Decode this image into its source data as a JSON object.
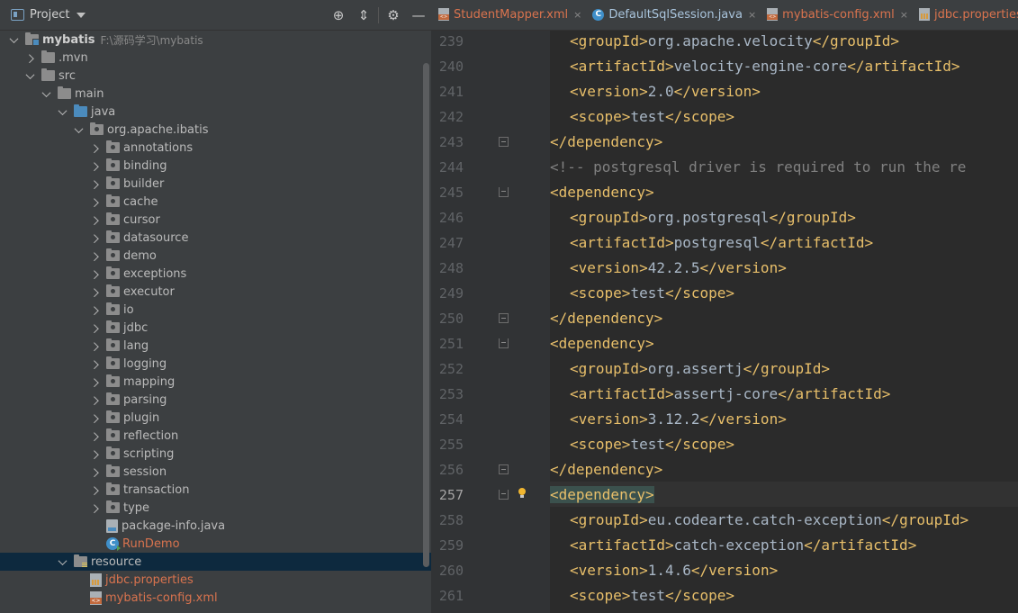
{
  "project_panel": {
    "title": "Project",
    "tools": [
      {
        "name": "locate-icon",
        "glyph": "⊕"
      },
      {
        "name": "collapse-all-icon",
        "glyph": "⇕"
      },
      {
        "name": "gear-icon",
        "glyph": "⚙"
      },
      {
        "name": "minimize-icon",
        "glyph": "—"
      }
    ]
  },
  "tree": [
    {
      "depth": 0,
      "chevron": "down",
      "icon": "folder module",
      "label": "mybatis",
      "bold": true,
      "path": "F:\\源码学习\\mybatis"
    },
    {
      "depth": 1,
      "chevron": "right",
      "icon": "folder",
      "label": ".mvn"
    },
    {
      "depth": 1,
      "chevron": "down",
      "icon": "folder",
      "label": "src"
    },
    {
      "depth": 2,
      "chevron": "down",
      "icon": "folder",
      "label": "main"
    },
    {
      "depth": 3,
      "chevron": "down",
      "icon": "folder blue",
      "label": "java"
    },
    {
      "depth": 4,
      "chevron": "down",
      "icon": "folder pkg",
      "label": "org.apache.ibatis"
    },
    {
      "depth": 5,
      "chevron": "right",
      "icon": "folder pkg",
      "label": "annotations"
    },
    {
      "depth": 5,
      "chevron": "right",
      "icon": "folder pkg",
      "label": "binding"
    },
    {
      "depth": 5,
      "chevron": "right",
      "icon": "folder pkg",
      "label": "builder"
    },
    {
      "depth": 5,
      "chevron": "right",
      "icon": "folder pkg",
      "label": "cache"
    },
    {
      "depth": 5,
      "chevron": "right",
      "icon": "folder pkg",
      "label": "cursor"
    },
    {
      "depth": 5,
      "chevron": "right",
      "icon": "folder pkg",
      "label": "datasource"
    },
    {
      "depth": 5,
      "chevron": "right",
      "icon": "folder pkg",
      "label": "demo"
    },
    {
      "depth": 5,
      "chevron": "right",
      "icon": "folder pkg",
      "label": "exceptions"
    },
    {
      "depth": 5,
      "chevron": "right",
      "icon": "folder pkg",
      "label": "executor"
    },
    {
      "depth": 5,
      "chevron": "right",
      "icon": "folder pkg",
      "label": "io"
    },
    {
      "depth": 5,
      "chevron": "right",
      "icon": "folder pkg",
      "label": "jdbc"
    },
    {
      "depth": 5,
      "chevron": "right",
      "icon": "folder pkg",
      "label": "lang"
    },
    {
      "depth": 5,
      "chevron": "right",
      "icon": "folder pkg",
      "label": "logging"
    },
    {
      "depth": 5,
      "chevron": "right",
      "icon": "folder pkg",
      "label": "mapping"
    },
    {
      "depth": 5,
      "chevron": "right",
      "icon": "folder pkg",
      "label": "parsing"
    },
    {
      "depth": 5,
      "chevron": "right",
      "icon": "folder pkg",
      "label": "plugin"
    },
    {
      "depth": 5,
      "chevron": "right",
      "icon": "folder pkg",
      "label": "reflection"
    },
    {
      "depth": 5,
      "chevron": "right",
      "icon": "folder pkg",
      "label": "scripting"
    },
    {
      "depth": 5,
      "chevron": "right",
      "icon": "folder pkg",
      "label": "session"
    },
    {
      "depth": 5,
      "chevron": "right",
      "icon": "folder pkg",
      "label": "transaction"
    },
    {
      "depth": 5,
      "chevron": "right",
      "icon": "folder pkg",
      "label": "type"
    },
    {
      "depth": 5,
      "chevron": "none",
      "icon": "file",
      "label": "package-info.java"
    },
    {
      "depth": 5,
      "chevron": "none",
      "icon": "cls",
      "label": "RunDemo",
      "orange": true
    },
    {
      "depth": 3,
      "chevron": "down",
      "icon": "folder res",
      "label": "resource",
      "selected": true
    },
    {
      "depth": 4,
      "chevron": "none",
      "icon": "props",
      "label": "jdbc.properties",
      "orange": true
    },
    {
      "depth": 4,
      "chevron": "none",
      "icon": "xml",
      "label": "mybatis-config.xml",
      "orange": true
    }
  ],
  "tabs": [
    {
      "icon": "xml",
      "label": "StudentMapper.xml",
      "color": "#d9734e"
    },
    {
      "icon": "cls",
      "label": "DefaultSqlSession.java",
      "color": "#a9c4dc"
    },
    {
      "icon": "xml",
      "label": "mybatis-config.xml",
      "color": "#d9734e"
    },
    {
      "icon": "props",
      "label": "jdbc.properties",
      "color": "#d9734e"
    }
  ],
  "editor": {
    "current_line": "257",
    "lines": [
      {
        "n": "239",
        "indent": 1,
        "parts": [
          {
            "c": "tag",
            "t": "<groupId>"
          },
          {
            "c": "txt",
            "t": "org.apache.velocity"
          },
          {
            "c": "tag",
            "t": "</groupId>"
          }
        ]
      },
      {
        "n": "240",
        "indent": 1,
        "parts": [
          {
            "c": "tag",
            "t": "<artifactId>"
          },
          {
            "c": "txt",
            "t": "velocity-engine-core"
          },
          {
            "c": "tag",
            "t": "</artifactId>"
          }
        ]
      },
      {
        "n": "241",
        "indent": 1,
        "parts": [
          {
            "c": "tag",
            "t": "<version>"
          },
          {
            "c": "txt",
            "t": "2.0"
          },
          {
            "c": "tag",
            "t": "</version>"
          }
        ]
      },
      {
        "n": "242",
        "indent": 1,
        "parts": [
          {
            "c": "tag",
            "t": "<scope>"
          },
          {
            "c": "txt",
            "t": "test"
          },
          {
            "c": "tag",
            "t": "</scope>"
          }
        ]
      },
      {
        "n": "243",
        "indent": 0,
        "fold": "end",
        "parts": [
          {
            "c": "tag",
            "t": "</dependency>"
          }
        ]
      },
      {
        "n": "244",
        "indent": 0,
        "parts": [
          {
            "c": "cmt",
            "t": "<!-- postgresql driver is required to run the re"
          }
        ]
      },
      {
        "n": "245",
        "indent": 0,
        "fold": "start",
        "parts": [
          {
            "c": "tag",
            "t": "<dependency>"
          }
        ]
      },
      {
        "n": "246",
        "indent": 1,
        "parts": [
          {
            "c": "tag",
            "t": "<groupId>"
          },
          {
            "c": "txt",
            "t": "org.postgresql"
          },
          {
            "c": "tag",
            "t": "</groupId>"
          }
        ]
      },
      {
        "n": "247",
        "indent": 1,
        "parts": [
          {
            "c": "tag",
            "t": "<artifactId>"
          },
          {
            "c": "txt",
            "t": "postgresql"
          },
          {
            "c": "tag",
            "t": "</artifactId>"
          }
        ]
      },
      {
        "n": "248",
        "indent": 1,
        "parts": [
          {
            "c": "tag",
            "t": "<version>"
          },
          {
            "c": "txt",
            "t": "42.2.5"
          },
          {
            "c": "tag",
            "t": "</version>"
          }
        ]
      },
      {
        "n": "249",
        "indent": 1,
        "parts": [
          {
            "c": "tag",
            "t": "<scope>"
          },
          {
            "c": "txt",
            "t": "test"
          },
          {
            "c": "tag",
            "t": "</scope>"
          }
        ]
      },
      {
        "n": "250",
        "indent": 0,
        "fold": "end",
        "parts": [
          {
            "c": "tag",
            "t": "</dependency>"
          }
        ]
      },
      {
        "n": "251",
        "indent": 0,
        "fold": "start",
        "parts": [
          {
            "c": "tag",
            "t": "<dependency>"
          }
        ]
      },
      {
        "n": "252",
        "indent": 1,
        "parts": [
          {
            "c": "tag",
            "t": "<groupId>"
          },
          {
            "c": "txt",
            "t": "org.assertj"
          },
          {
            "c": "tag",
            "t": "</groupId>"
          }
        ]
      },
      {
        "n": "253",
        "indent": 1,
        "parts": [
          {
            "c": "tag",
            "t": "<artifactId>"
          },
          {
            "c": "txt",
            "t": "assertj-core"
          },
          {
            "c": "tag",
            "t": "</artifactId>"
          }
        ]
      },
      {
        "n": "254",
        "indent": 1,
        "parts": [
          {
            "c": "tag",
            "t": "<version>"
          },
          {
            "c": "txt",
            "t": "3.12.2"
          },
          {
            "c": "tag",
            "t": "</version>"
          }
        ]
      },
      {
        "n": "255",
        "indent": 1,
        "parts": [
          {
            "c": "tag",
            "t": "<scope>"
          },
          {
            "c": "txt",
            "t": "test"
          },
          {
            "c": "tag",
            "t": "</scope>"
          }
        ]
      },
      {
        "n": "256",
        "indent": 0,
        "fold": "end",
        "parts": [
          {
            "c": "tag",
            "t": "</dependency>"
          }
        ]
      },
      {
        "n": "257",
        "indent": 0,
        "fold": "start",
        "bulb": true,
        "caret": true,
        "parts": [
          {
            "c": "tag-hl",
            "t": "<dependency>"
          }
        ]
      },
      {
        "n": "258",
        "indent": 1,
        "parts": [
          {
            "c": "tag",
            "t": "<groupId>"
          },
          {
            "c": "txt",
            "t": "eu.codearte.catch-exception"
          },
          {
            "c": "tag",
            "t": "</groupId>"
          }
        ]
      },
      {
        "n": "259",
        "indent": 1,
        "parts": [
          {
            "c": "tag",
            "t": "<artifactId>"
          },
          {
            "c": "txt",
            "t": "catch-exception"
          },
          {
            "c": "tag",
            "t": "</artifactId>"
          }
        ]
      },
      {
        "n": "260",
        "indent": 1,
        "parts": [
          {
            "c": "tag",
            "t": "<version>"
          },
          {
            "c": "txt",
            "t": "1.4.6"
          },
          {
            "c": "tag",
            "t": "</version>"
          }
        ]
      },
      {
        "n": "261",
        "indent": 1,
        "parts": [
          {
            "c": "tag",
            "t": "<scope>"
          },
          {
            "c": "txt",
            "t": "test"
          },
          {
            "c": "tag",
            "t": "</scope>"
          }
        ]
      }
    ]
  }
}
